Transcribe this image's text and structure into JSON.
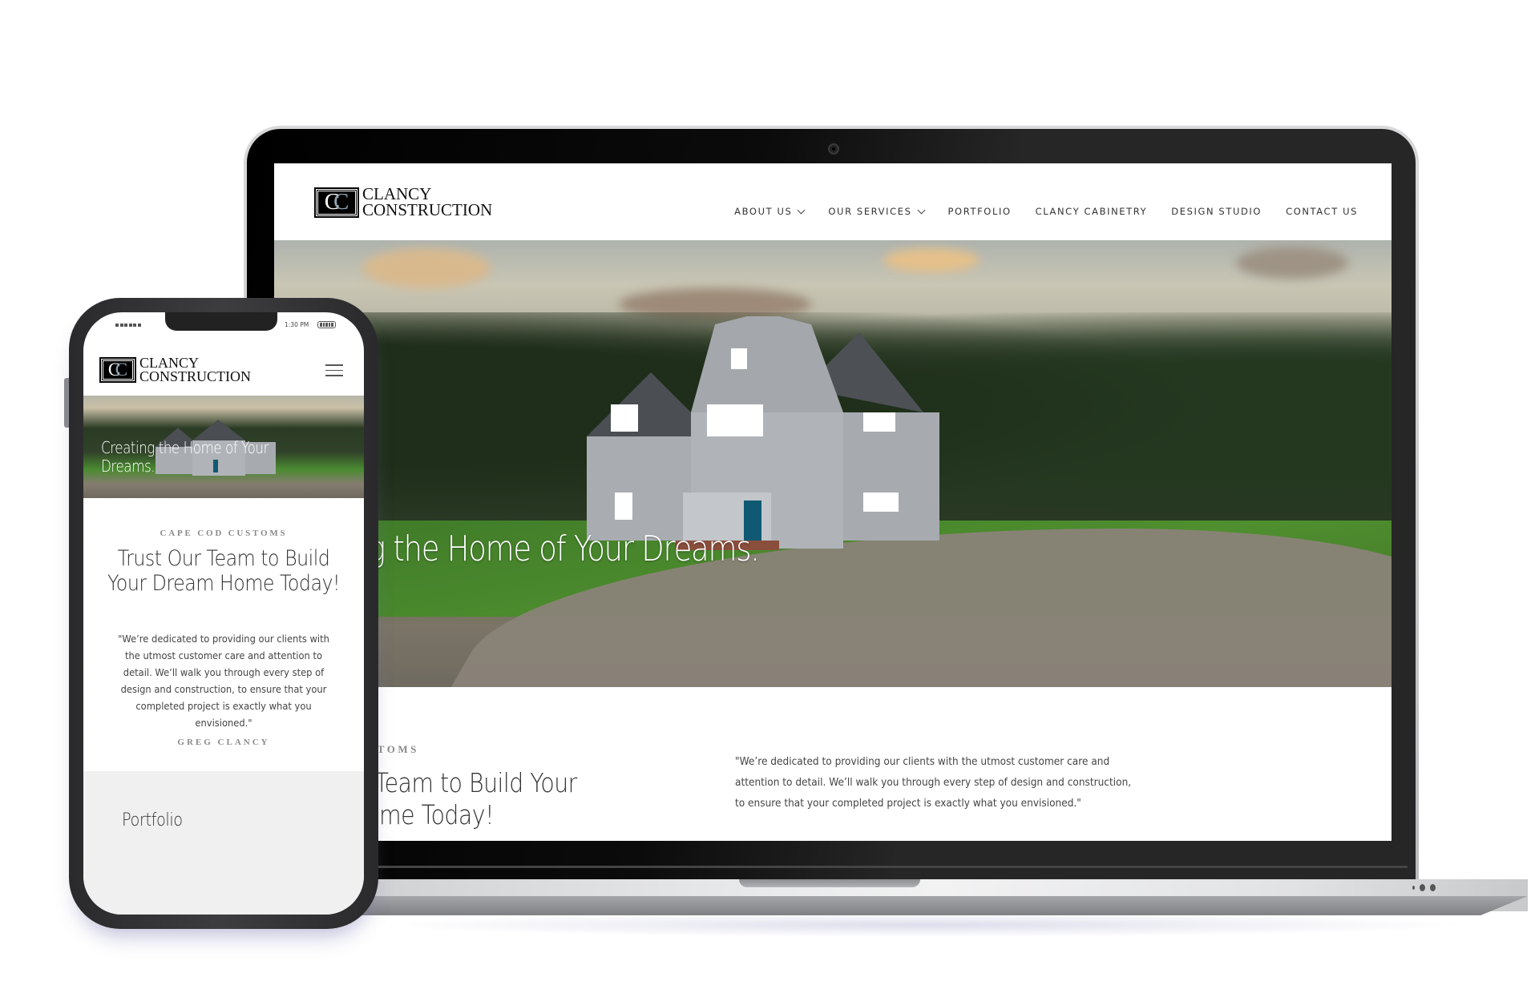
{
  "brand": {
    "monogram": [
      "C",
      "C"
    ],
    "name_line1": "CLANCY",
    "name_line2": "CONSTRUCTION",
    "colors": {
      "monogram_accent": "#8fa3b2",
      "text": "#333333",
      "eyebrow": "#8a8a8a"
    }
  },
  "desktop": {
    "nav": [
      {
        "label": "ABOUT US",
        "has_dropdown": true
      },
      {
        "label": "OUR SERVICES",
        "has_dropdown": true
      },
      {
        "label": "PORTFOLIO",
        "has_dropdown": false
      },
      {
        "label": "CLANCY CABINETRY",
        "has_dropdown": false
      },
      {
        "label": "DESIGN STUDIO",
        "has_dropdown": false
      },
      {
        "label": "CONTACT US",
        "has_dropdown": false
      }
    ],
    "hero_title": "Creating the Home of Your Dreams.",
    "eyebrow": "CAPE COD CUSTOMS",
    "heading": "Trust Our Team to Build Your Dream Home Today!",
    "quote": "\"We’re dedicated to providing our clients with the utmost customer care and attention to detail. We’ll walk you through every step of design and construction, to ensure that your completed project is exactly what you envisioned.\""
  },
  "mobile": {
    "status_bar": {
      "time": "1:30 PM",
      "signal_icon": "signal-dots-icon",
      "battery_icon": "battery-icon"
    },
    "menu_icon": "hamburger-menu-icon",
    "hero_title": "Creating the Home of Your Dreams.",
    "eyebrow": "CAPE COD CUSTOMS",
    "heading": "Trust Our Team to Build Your Dream Home Today!",
    "quote": "\"We’re dedicated to providing our clients with the utmost customer care and attention to detail. We’ll walk you through every step of design and construction, to ensure that your completed project is exactly what you envisioned.\"",
    "author": "GREG CLANCY",
    "next_section_title": "Portfolio"
  }
}
